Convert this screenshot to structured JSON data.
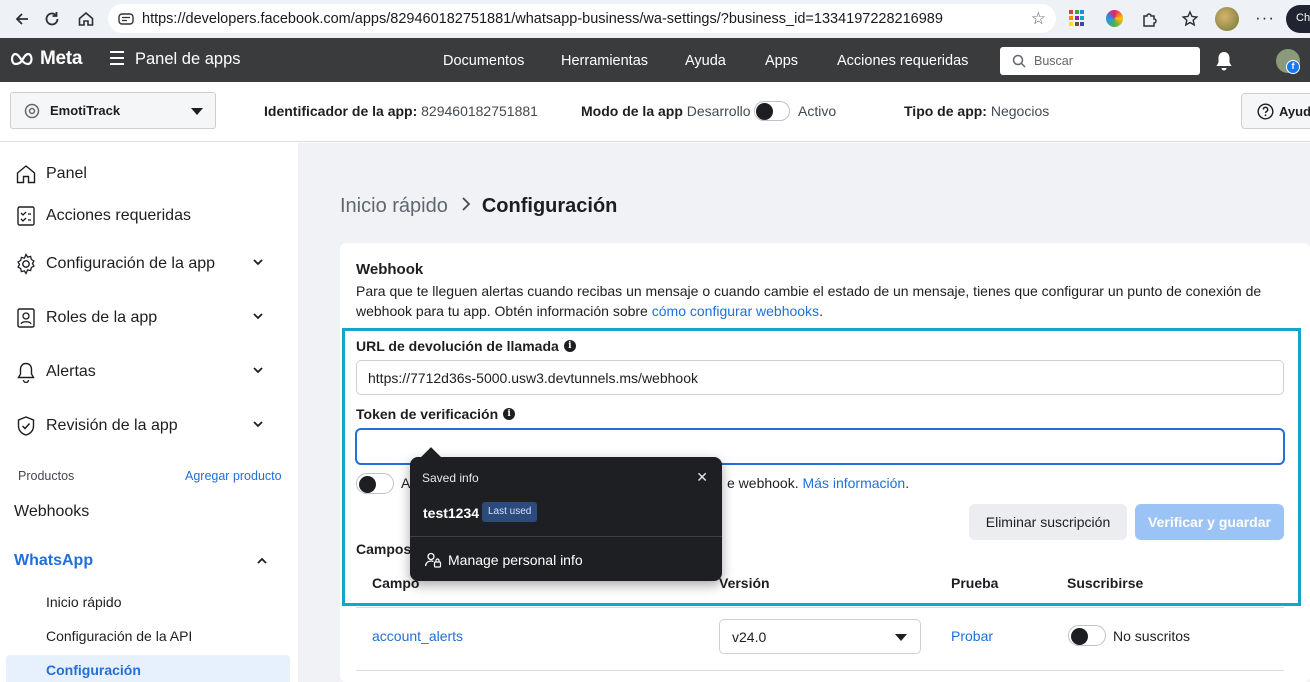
{
  "browser": {
    "url": "https://developers.facebook.com/apps/829460182751881/whatsapp-business/wa-settings/?business_id=1334197228216989",
    "profile_label": "Cha"
  },
  "nav": {
    "logo": "Meta",
    "panel_title": "Panel de apps",
    "links": [
      "Documentos",
      "Herramientas",
      "Ayuda",
      "Apps",
      "Acciones requeridas"
    ],
    "search_placeholder": "Buscar"
  },
  "app_bar": {
    "app_name": "EmotiTrack",
    "app_id_label": "Identificador de la app:",
    "app_id": "829460182751881",
    "mode_label": "Modo de la app",
    "mode_dev": "Desarrollo",
    "mode_active": "Activo",
    "type_label": "Tipo de app:",
    "type_value": "Negocios",
    "help": "Ayuda"
  },
  "sidebar": {
    "items": [
      {
        "label": "Panel",
        "icon": "home-icon"
      },
      {
        "label": "Acciones requeridas",
        "icon": "checklist-icon"
      },
      {
        "label": "Configuración de la app",
        "icon": "gear-icon"
      },
      {
        "label": "Roles de la app",
        "icon": "person-badge-icon"
      },
      {
        "label": "Alertas",
        "icon": "bell-icon"
      },
      {
        "label": "Revisión de la app",
        "icon": "shield-check-icon"
      }
    ],
    "products_label": "Productos",
    "add_product": "Agregar producto",
    "webhooks": "Webhooks",
    "whatsapp": "WhatsApp",
    "sub_items": [
      "Inicio rápido",
      "Configuración de la API",
      "Configuración"
    ]
  },
  "main": {
    "breadcrumb_prev": "Inicio rápido",
    "breadcrumb_current": "Configuración",
    "webhook_title": "Webhook",
    "webhook_desc_1": "Para que te lleguen alertas cuando recibas un mensaje o cuando cambie el estado de un mensaje, tienes que configurar un punto de conexión de webhook para tu app. Obtén información sobre ",
    "webhook_desc_link": "cómo configurar webhooks",
    "webhook_desc_end": ".",
    "callback_label": "URL de devolución de llamada",
    "callback_value": "https://7712d36s-5000.usw3.devtunnels.ms/webhook",
    "token_label": "Token de verificación",
    "token_value": "",
    "toggle_text_start": "A",
    "toggle_text_mid": "e webhook.",
    "toggle_link": "Más información",
    "toggle_text_end": ".",
    "delete_btn": "Eliminar suscripción",
    "verify_btn": "Verificar y guardar",
    "fields_label": "Campos",
    "columns": [
      "Campo",
      "Versión",
      "Prueba",
      "Suscribirse"
    ],
    "rows": [
      {
        "field": "account_alerts",
        "version": "v24.0",
        "test": "Probar",
        "subscribe": "No suscritos"
      }
    ]
  },
  "autofill": {
    "title": "Saved info",
    "close": "✕",
    "value": "test1234",
    "badge": "Last used",
    "manage": "Manage personal info"
  }
}
